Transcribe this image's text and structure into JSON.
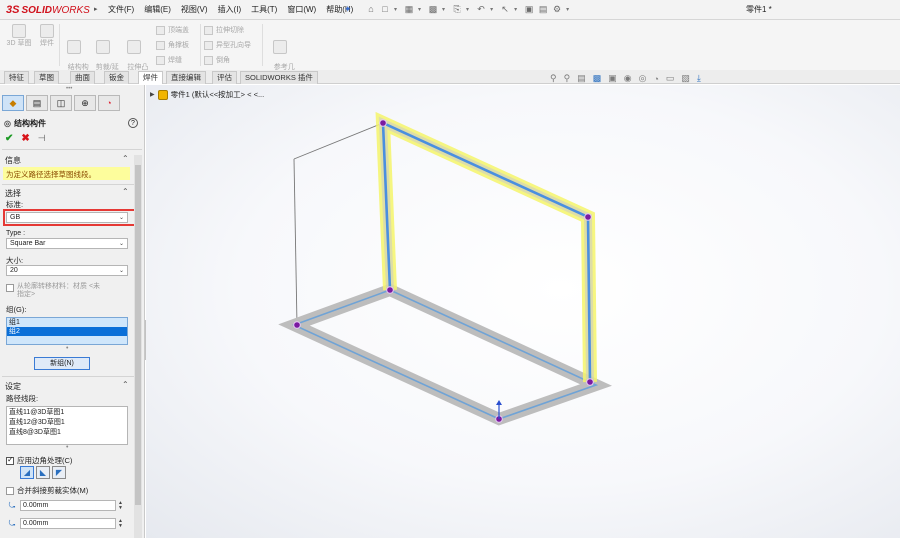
{
  "app": {
    "logo_prefix": "3S",
    "logo_solid": "SOLID",
    "logo_works": "WORKS",
    "document_title": "零件1 *"
  },
  "menu": [
    "文件(F)",
    "编辑(E)",
    "视图(V)",
    "插入(I)",
    "工具(T)",
    "窗口(W)",
    "帮助(H)"
  ],
  "ribbon": {
    "sketch3d": "3D 草图",
    "weldment": "焊件",
    "struct_member": "结构构\n件",
    "trim_extend": "剪裁/延\n伸",
    "extrude_boss": "拉伸凸\n台/基体",
    "end_cap": "顶端盖",
    "gusset": "角撑板",
    "weld_bead": "焊缝",
    "extrude_cut": "拉伸切除",
    "hole_wizard": "异型孔向导",
    "chamfer": "倒角",
    "ref_geometry": "参考几\n何体"
  },
  "tabs": [
    "特征",
    "草图",
    "曲面",
    "钣金",
    "焊件",
    "直接编辑",
    "评估",
    "SOLIDWORKS 插件"
  ],
  "active_tab": "焊件",
  "panel": {
    "title": "结构构件",
    "help": "?",
    "info_title": "信息",
    "info_message": "为定义路径选择草图线段。",
    "selection_title": "选择",
    "standard_label": "标准:",
    "standard_value": "GB",
    "type_label": "Type :",
    "type_value": "Square Bar",
    "size_label": "大小:",
    "size_value": "20",
    "material_check": "从轮廓转移材料：材质 <未\n指定>",
    "group_label": "组(G):",
    "groups": [
      "组1",
      "组2"
    ],
    "selected_group": "组2",
    "new_group_button": "新组(N)",
    "settings_title": "设定",
    "path_label": "路径线段:",
    "path_segments": [
      "直线11@3D草图1",
      "直线12@3D草图1",
      "直线8@3D草图1"
    ],
    "apply_corner": "应用边角处理(C)",
    "apply_corner_checked": true,
    "merge_miter": "合并斜接剪裁实体(M)",
    "merge_miter_checked": false,
    "gap1": "0.00mm",
    "gap2": "0.00mm"
  },
  "tree": {
    "label": "零件1  (默认<<按加工> < <..."
  },
  "colors": {
    "accent_blue": "#3a7bd5",
    "selection_yellow": "#fdfd9c",
    "highlight_red": "#e53935",
    "logo_red": "#d0101b"
  }
}
